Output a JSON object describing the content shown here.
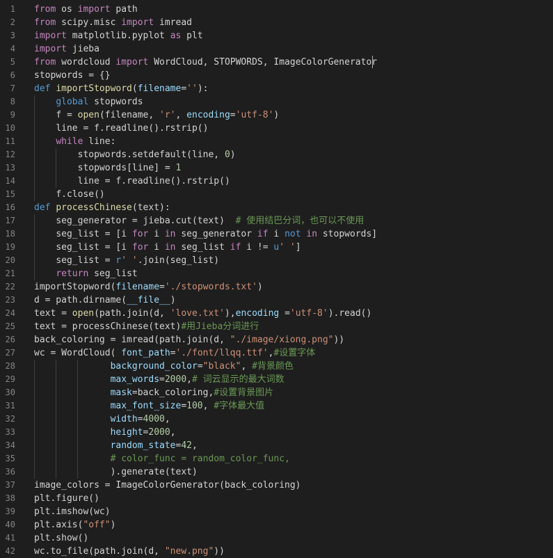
{
  "editor": {
    "lines": [
      {
        "n": "1",
        "indent": 0,
        "tokens": [
          [
            "from",
            "ctl"
          ],
          [
            " os ",
            "txt"
          ],
          [
            "import",
            "ctl"
          ],
          [
            " path",
            "txt"
          ]
        ]
      },
      {
        "n": "2",
        "indent": 0,
        "tokens": [
          [
            "from",
            "ctl"
          ],
          [
            " scipy.misc ",
            "txt"
          ],
          [
            "import",
            "ctl"
          ],
          [
            " imread",
            "txt"
          ]
        ]
      },
      {
        "n": "3",
        "indent": 0,
        "tokens": [
          [
            "import",
            "ctl"
          ],
          [
            " matplotlib.pyplot ",
            "txt"
          ],
          [
            "as",
            "ctl"
          ],
          [
            " plt",
            "txt"
          ]
        ]
      },
      {
        "n": "4",
        "indent": 0,
        "tokens": [
          [
            "import",
            "ctl"
          ],
          [
            " jieba",
            "txt"
          ]
        ]
      },
      {
        "n": "5",
        "indent": 0,
        "tokens": [
          [
            "from",
            "ctl"
          ],
          [
            " wordcloud ",
            "txt"
          ],
          [
            "import",
            "ctl"
          ],
          [
            " WordCloud, STOPWORDS, ImageColorGenerator",
            "txt"
          ]
        ]
      },
      {
        "n": "6",
        "indent": 0,
        "tokens": [
          [
            "stopwords = {}",
            "txt"
          ]
        ]
      },
      {
        "n": "7",
        "indent": 0,
        "tokens": [
          [
            "def",
            "kw"
          ],
          [
            " ",
            "txt"
          ],
          [
            "importStopword",
            "fn"
          ],
          [
            "(",
            "txt"
          ],
          [
            "filename",
            "var"
          ],
          [
            "=",
            "txt"
          ],
          [
            "''",
            "str"
          ],
          [
            "):",
            "txt"
          ]
        ]
      },
      {
        "n": "8",
        "indent": 1,
        "tokens": [
          [
            "global",
            "kw"
          ],
          [
            " stopwords",
            "txt"
          ]
        ]
      },
      {
        "n": "9",
        "indent": 1,
        "tokens": [
          [
            "f = ",
            "txt"
          ],
          [
            "open",
            "fn"
          ],
          [
            "(filename, ",
            "txt"
          ],
          [
            "'r'",
            "str"
          ],
          [
            ", ",
            "txt"
          ],
          [
            "encoding",
            "var"
          ],
          [
            "=",
            "txt"
          ],
          [
            "'utf-8'",
            "str"
          ],
          [
            ")",
            "txt"
          ]
        ]
      },
      {
        "n": "10",
        "indent": 1,
        "tokens": [
          [
            "line = f.readline().rstrip()",
            "txt"
          ]
        ]
      },
      {
        "n": "11",
        "indent": 1,
        "tokens": [
          [
            "while",
            "ctl"
          ],
          [
            " line:",
            "txt"
          ]
        ]
      },
      {
        "n": "12",
        "indent": 2,
        "tokens": [
          [
            "stopwords.setdefault(line, ",
            "txt"
          ],
          [
            "0",
            "num"
          ],
          [
            ")",
            "txt"
          ]
        ]
      },
      {
        "n": "13",
        "indent": 2,
        "tokens": [
          [
            "stopwords[line] = ",
            "txt"
          ],
          [
            "1",
            "num"
          ]
        ]
      },
      {
        "n": "14",
        "indent": 2,
        "tokens": [
          [
            "line = f.readline().rstrip()",
            "txt"
          ]
        ]
      },
      {
        "n": "15",
        "indent": 1,
        "tokens": [
          [
            "f.close()",
            "txt"
          ]
        ]
      },
      {
        "n": "16",
        "indent": 0,
        "tokens": [
          [
            "def",
            "kw"
          ],
          [
            " ",
            "txt"
          ],
          [
            "processChinese",
            "fn"
          ],
          [
            "(text):",
            "txt"
          ]
        ]
      },
      {
        "n": "17",
        "indent": 1,
        "tokens": [
          [
            "seg_generator = jieba.cut(text)  ",
            "txt"
          ],
          [
            "# 使用结巴分词，也可以不使用",
            "cmt"
          ]
        ]
      },
      {
        "n": "18",
        "indent": 1,
        "tokens": [
          [
            "seg_list = [i ",
            "txt"
          ],
          [
            "for",
            "ctl"
          ],
          [
            " i ",
            "txt"
          ],
          [
            "in",
            "ctl"
          ],
          [
            " seg_generator ",
            "txt"
          ],
          [
            "if",
            "ctl"
          ],
          [
            " i ",
            "txt"
          ],
          [
            "not",
            "kw"
          ],
          [
            " ",
            "txt"
          ],
          [
            "in",
            "ctl"
          ],
          [
            " stopwords]",
            "txt"
          ]
        ]
      },
      {
        "n": "19",
        "indent": 1,
        "tokens": [
          [
            "seg_list = [i ",
            "txt"
          ],
          [
            "for",
            "ctl"
          ],
          [
            " i ",
            "txt"
          ],
          [
            "in",
            "ctl"
          ],
          [
            " seg_list ",
            "txt"
          ],
          [
            "if",
            "ctl"
          ],
          [
            " i != ",
            "txt"
          ],
          [
            "u",
            "kw"
          ],
          [
            "' '",
            "str"
          ],
          [
            "]",
            "txt"
          ]
        ]
      },
      {
        "n": "20",
        "indent": 1,
        "tokens": [
          [
            "seg_list = ",
            "txt"
          ],
          [
            "r",
            "kw"
          ],
          [
            "' '",
            "str"
          ],
          [
            ".join(seg_list)",
            "txt"
          ]
        ]
      },
      {
        "n": "21",
        "indent": 1,
        "tokens": [
          [
            "return",
            "ctl"
          ],
          [
            " seg_list",
            "txt"
          ]
        ]
      },
      {
        "n": "22",
        "indent": 0,
        "tokens": [
          [
            "importStopword(",
            "txt"
          ],
          [
            "filename",
            "var"
          ],
          [
            "=",
            "txt"
          ],
          [
            "'./stopwords.txt'",
            "str"
          ],
          [
            ")",
            "txt"
          ]
        ]
      },
      {
        "n": "23",
        "indent": 0,
        "tokens": [
          [
            "d = path.dirname(",
            "txt"
          ],
          [
            "__file__",
            "var"
          ],
          [
            ")",
            "txt"
          ]
        ]
      },
      {
        "n": "24",
        "indent": 0,
        "tokens": [
          [
            "text = ",
            "txt"
          ],
          [
            "open",
            "fn"
          ],
          [
            "(path.join(d, ",
            "txt"
          ],
          [
            "'love.txt'",
            "str"
          ],
          [
            "),",
            "txt"
          ],
          [
            "encoding",
            "var"
          ],
          [
            " =",
            "txt"
          ],
          [
            "'utf-8'",
            "str"
          ],
          [
            ").read()",
            "txt"
          ]
        ]
      },
      {
        "n": "25",
        "indent": 0,
        "tokens": [
          [
            "text = processChinese(text)",
            "txt"
          ],
          [
            "#用Jieba分词进行",
            "cmt"
          ]
        ]
      },
      {
        "n": "26",
        "indent": 0,
        "tokens": [
          [
            "back_coloring = imread(path.join(d, ",
            "txt"
          ],
          [
            "\"./image/xiong.png\"",
            "str"
          ],
          [
            "))",
            "txt"
          ]
        ]
      },
      {
        "n": "27",
        "indent": 0,
        "tokens": [
          [
            "wc = WordCloud( ",
            "txt"
          ],
          [
            "font_path",
            "var"
          ],
          [
            "=",
            "txt"
          ],
          [
            "'./font/llqq.ttf'",
            "str"
          ],
          [
            ",",
            "txt"
          ],
          [
            "#设置字体",
            "cmt"
          ]
        ]
      },
      {
        "n": "28",
        "indent": 0,
        "guides": [
          1,
          2,
          3
        ],
        "pad": "              ",
        "tokens": [
          [
            "background_color",
            "var"
          ],
          [
            "=",
            "txt"
          ],
          [
            "\"black\"",
            "str"
          ],
          [
            ", ",
            "txt"
          ],
          [
            "#背景颜色",
            "cmt"
          ]
        ]
      },
      {
        "n": "29",
        "indent": 0,
        "guides": [
          1,
          2,
          3
        ],
        "pad": "              ",
        "tokens": [
          [
            "max_words",
            "var"
          ],
          [
            "=",
            "txt"
          ],
          [
            "2000",
            "num"
          ],
          [
            ",",
            "txt"
          ],
          [
            "# 词云显示的最大词数",
            "cmt"
          ]
        ]
      },
      {
        "n": "30",
        "indent": 0,
        "guides": [
          1,
          2,
          3
        ],
        "pad": "              ",
        "tokens": [
          [
            "mask",
            "var"
          ],
          [
            "=back_coloring,",
            "txt"
          ],
          [
            "#设置背景图片",
            "cmt"
          ]
        ]
      },
      {
        "n": "31",
        "indent": 0,
        "guides": [
          1,
          2,
          3
        ],
        "pad": "              ",
        "tokens": [
          [
            "max_font_size",
            "var"
          ],
          [
            "=",
            "txt"
          ],
          [
            "100",
            "num"
          ],
          [
            ", ",
            "txt"
          ],
          [
            "#字体最大值",
            "cmt"
          ]
        ]
      },
      {
        "n": "32",
        "indent": 0,
        "guides": [
          1,
          2,
          3
        ],
        "pad": "              ",
        "tokens": [
          [
            "width",
            "var"
          ],
          [
            "=",
            "txt"
          ],
          [
            "4000",
            "num"
          ],
          [
            ",",
            "txt"
          ]
        ]
      },
      {
        "n": "33",
        "indent": 0,
        "guides": [
          1,
          2,
          3
        ],
        "pad": "              ",
        "tokens": [
          [
            "height",
            "var"
          ],
          [
            "=",
            "txt"
          ],
          [
            "2000",
            "num"
          ],
          [
            ",",
            "txt"
          ]
        ]
      },
      {
        "n": "34",
        "indent": 0,
        "guides": [
          1,
          2,
          3
        ],
        "pad": "              ",
        "tokens": [
          [
            "random_state",
            "var"
          ],
          [
            "=",
            "txt"
          ],
          [
            "42",
            "num"
          ],
          [
            ",",
            "txt"
          ]
        ]
      },
      {
        "n": "35",
        "indent": 0,
        "guides": [
          1,
          2,
          3
        ],
        "pad": "              ",
        "tokens": [
          [
            "# color_func = random_color_func,",
            "cmt"
          ]
        ]
      },
      {
        "n": "36",
        "indent": 0,
        "guides": [
          1,
          2,
          3
        ],
        "pad": "              ",
        "tokens": [
          [
            ").generate(text)",
            "txt"
          ]
        ]
      },
      {
        "n": "37",
        "indent": 0,
        "tokens": [
          [
            "image_colors = ImageColorGenerator(back_coloring)",
            "txt"
          ]
        ]
      },
      {
        "n": "38",
        "indent": 0,
        "tokens": [
          [
            "plt.figure()",
            "txt"
          ]
        ]
      },
      {
        "n": "39",
        "indent": 0,
        "tokens": [
          [
            "plt.imshow(wc)",
            "txt"
          ]
        ]
      },
      {
        "n": "40",
        "indent": 0,
        "tokens": [
          [
            "plt.axis(",
            "txt"
          ],
          [
            "\"off\"",
            "str"
          ],
          [
            ")",
            "txt"
          ]
        ]
      },
      {
        "n": "41",
        "indent": 0,
        "tokens": [
          [
            "plt.show()",
            "txt"
          ]
        ]
      },
      {
        "n": "42",
        "indent": 0,
        "tokens": [
          [
            "wc.to_file(path.join(d, ",
            "txt"
          ],
          [
            "\"new.png\"",
            "str"
          ],
          [
            "))",
            "txt"
          ]
        ]
      }
    ]
  }
}
